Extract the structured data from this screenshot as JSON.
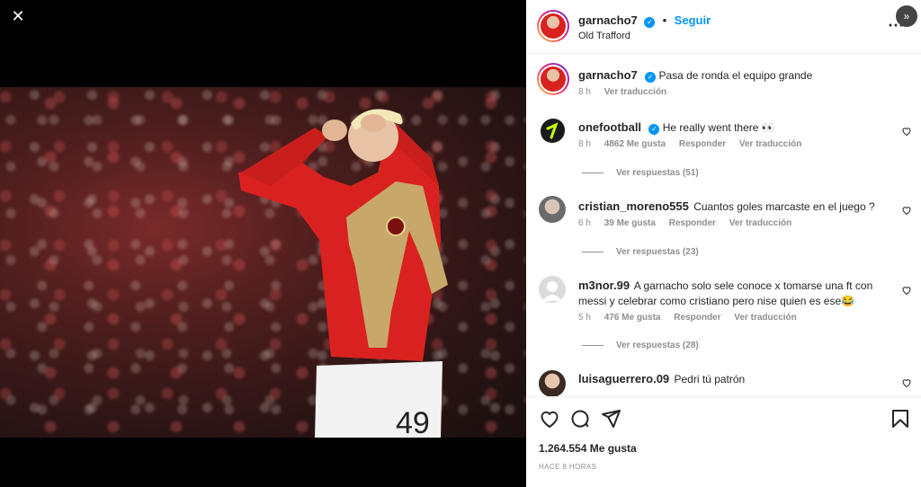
{
  "close_label": "✕",
  "header": {
    "username": "garnacho7",
    "follow": "Seguir",
    "dot": "•",
    "location": "Old Trafford",
    "more": "⋯",
    "next": "»"
  },
  "caption": {
    "username": "garnacho7",
    "text": "Pasa de ronda el equipo grande",
    "time": "8 h",
    "translate": "Ver traducción"
  },
  "comments": [
    {
      "username": "onefootball",
      "verified": true,
      "text": "He really went there 👀",
      "time": "8 h",
      "likes": "4862 Me gusta",
      "reply": "Responder",
      "translate": "Ver traducción",
      "replies": "Ver respuestas (51)"
    },
    {
      "username": "cristian_moreno555",
      "text": "Cuantos goles marcaste en el juego ?",
      "time": "6 h",
      "likes": "39 Me gusta",
      "reply": "Responder",
      "translate": "Ver traducción",
      "replies": "Ver respuestas (23)"
    },
    {
      "username": "m3nor.99",
      "text": "A garnacho solo sele conoce x tomarse una ft con messi y celebrar como cristiano pero nise quien es ese😂",
      "time": "5 h",
      "likes": "476 Me gusta",
      "reply": "Responder",
      "translate": "Ver traducción",
      "replies": "Ver respuestas (28)"
    },
    {
      "username": "luisaguerrero.09",
      "text": "Pedri tú patrón"
    }
  ],
  "footer": {
    "likes": "1.264.554 Me gusta",
    "time": "HACE 8 HORAS"
  },
  "colors": {
    "accent": "#0095f6",
    "jersey": "#d9221f",
    "muted": "#8e8e8e"
  }
}
